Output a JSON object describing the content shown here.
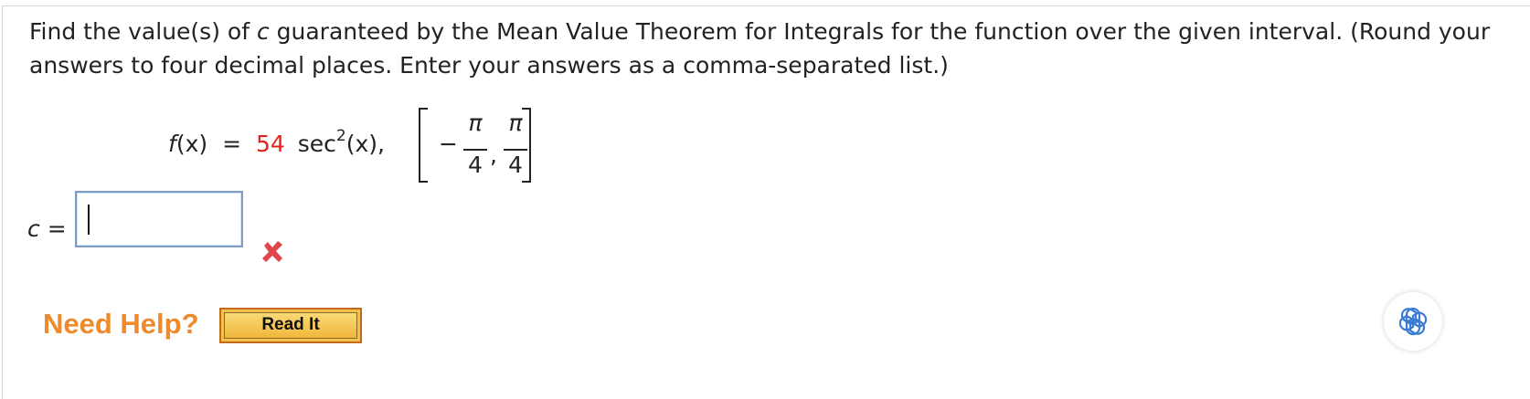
{
  "question": {
    "text_before": "Find the value(s) of ",
    "variable": "c",
    "text_after": " guaranteed by the Mean Value Theorem for Integrals for the function over the given interval. (Round your answers to four decimal places. Enter your answers as a comma-separated list.)"
  },
  "formula": {
    "lhs_f": "f",
    "lhs_x": "(x)",
    "equals": "=",
    "coefficient": "54",
    "func": "sec",
    "power": "2",
    "arg": "(x),",
    "interval": {
      "minus": "−",
      "num1": "π",
      "den1": "4",
      "comma": ",",
      "num2": "π",
      "den2": "4"
    }
  },
  "answer": {
    "label_var": "c",
    "label_equals": " =",
    "value": "",
    "status": "incorrect"
  },
  "help": {
    "need_help": "Need Help?",
    "read_it": "Read It"
  },
  "colors": {
    "coefficient": "#e8201a",
    "wrong_icon": "#e0474c",
    "need_help": "#ef8a2c",
    "read_it_bg": "#f2c14e",
    "input_border": "#7b9cc7"
  },
  "icons": {
    "wrong": "x-mark-icon",
    "assistant": "assistant-logo-icon"
  }
}
